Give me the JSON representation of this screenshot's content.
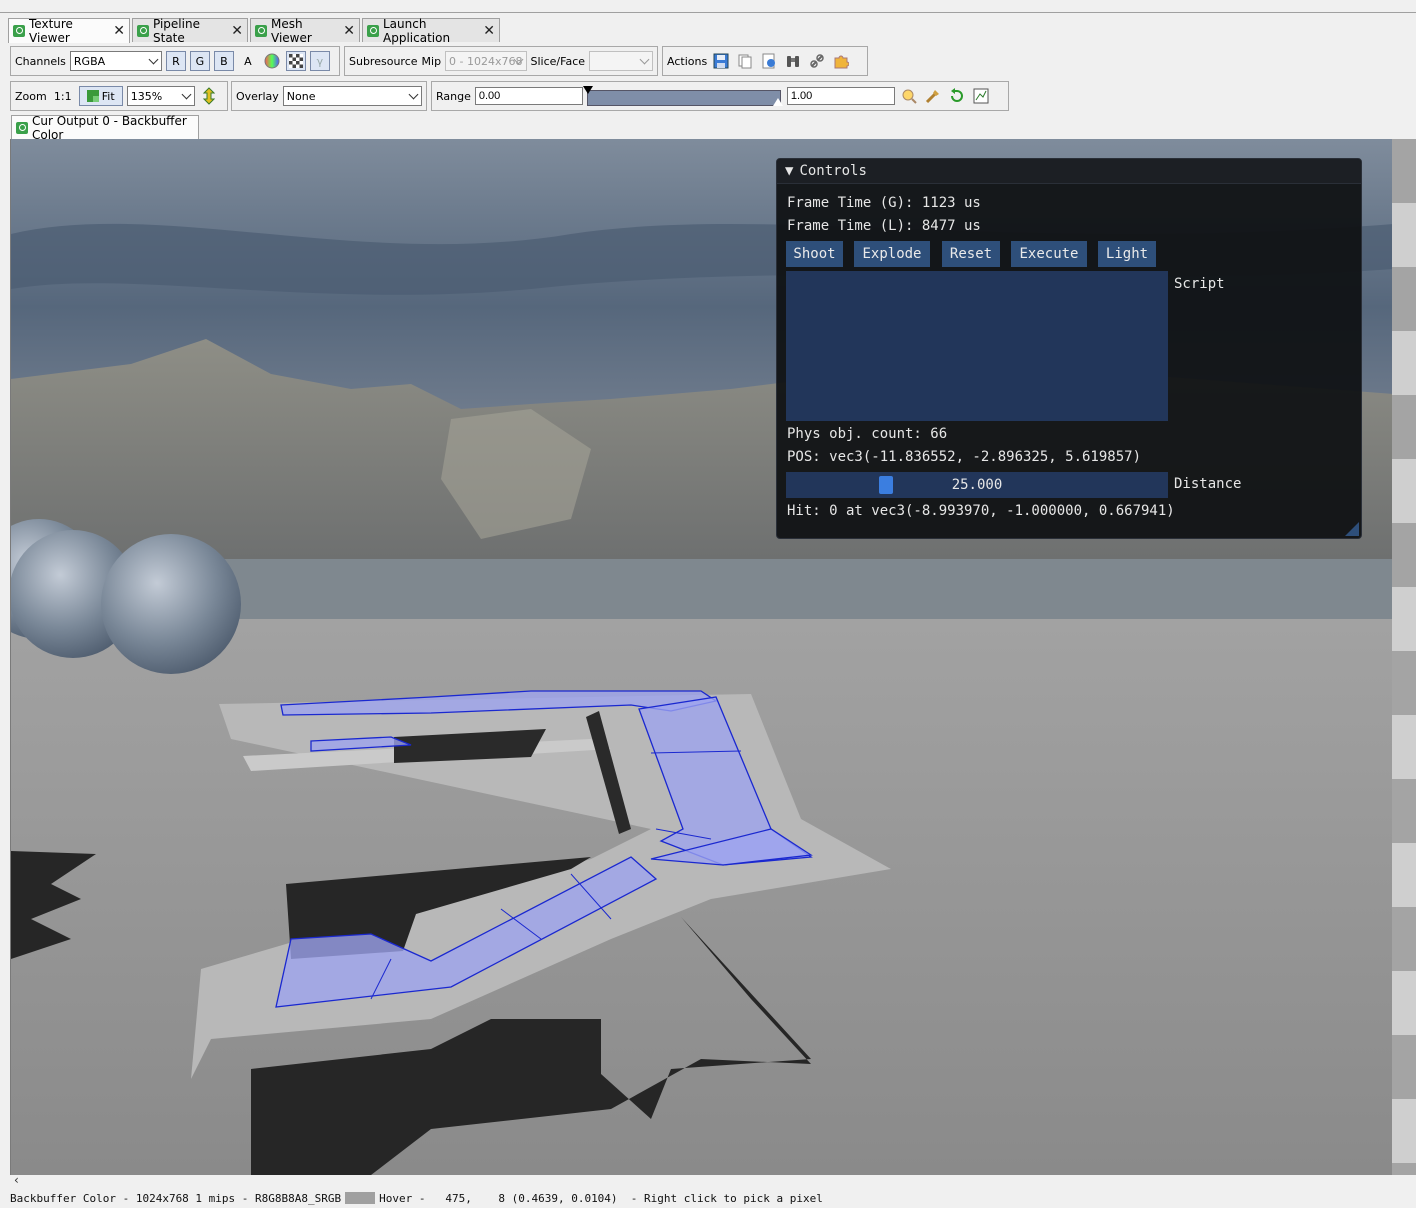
{
  "tabs": [
    {
      "label": "Texture Viewer",
      "active": true
    },
    {
      "label": "Pipeline State",
      "active": false
    },
    {
      "label": "Mesh Viewer",
      "active": false
    },
    {
      "label": "Launch Application",
      "active": false
    }
  ],
  "toolbar1": {
    "channels_label": "Channels",
    "channels_value": "RGBA",
    "r": "R",
    "g": "G",
    "b": "B",
    "a": "A",
    "subresource_label": "Subresource",
    "mip_label": "Mip",
    "mip_value": "0 - 1024x768",
    "slice_label": "Slice/Face",
    "slice_value": "",
    "actions_label": "Actions"
  },
  "toolbar2": {
    "zoom_label": "Zoom",
    "one_to_one": "1:1",
    "fit_label": "Fit",
    "zoom_value": "135%",
    "overlay_label": "Overlay",
    "overlay_value": "None",
    "range_label": "Range",
    "range_min": "0.00",
    "range_max": "1.00"
  },
  "output_tab": "Cur Output 0 - Backbuffer Color",
  "controls": {
    "title": "Controls",
    "frame_time_g": "Frame Time (G): 1123 us",
    "frame_time_l": "Frame Time (L): 8477 us",
    "buttons": [
      "Shoot",
      "Explode",
      "Reset",
      "Execute",
      "Light"
    ],
    "script_label": "Script",
    "phys_count": "Phys obj. count: 66",
    "pos": "POS: vec3(-11.836552, -2.896325, 5.619857)",
    "distance_value": "25.000",
    "distance_label": "Distance",
    "hit": "Hit: 0 at vec3(-8.993970, -1.000000, 0.667941)"
  },
  "status": {
    "info": "Backbuffer Color - 1024x768 1 mips - R8G8B8A8_SRGB",
    "hover": "Hover -   475,    8 (0.4639, 0.0104)  - Right click to pick a pixel"
  },
  "colors": {
    "panel_bg": "#0e1012",
    "button_bg": "#2e4f7a",
    "slider_grab": "#3b7ee0",
    "mesh_overlay": "#9ea4f0"
  }
}
